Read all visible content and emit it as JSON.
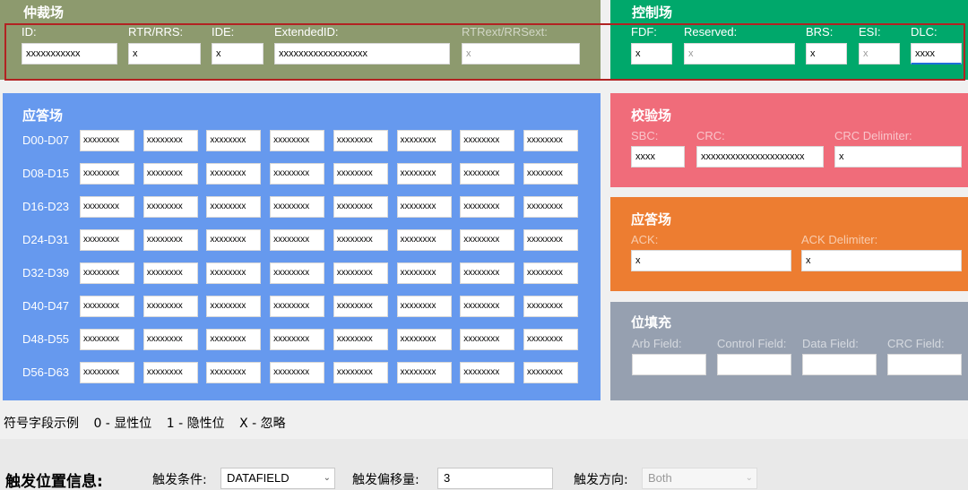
{
  "arbitration": {
    "title": "仲裁场",
    "fields": [
      {
        "label": "ID:",
        "value": "xxxxxxxxxxx"
      },
      {
        "label": "RTR/RRS:",
        "value": "x"
      },
      {
        "label": "IDE:",
        "value": "x"
      },
      {
        "label": "ExtendedID:",
        "value": "xxxxxxxxxxxxxxxxxx"
      },
      {
        "label": "RTRext/RRSext:",
        "value": "x"
      }
    ]
  },
  "control": {
    "title": "控制场",
    "fields": [
      {
        "label": "FDF:",
        "value": "x"
      },
      {
        "label": "Reserved:",
        "value": "x"
      },
      {
        "label": "BRS:",
        "value": "x"
      },
      {
        "label": "ESI:",
        "value": "x"
      },
      {
        "label": "DLC:",
        "value": "xxxx"
      }
    ]
  },
  "data": {
    "title": "应答场",
    "cell_value": "xxxxxxxx",
    "rows": [
      "D00-D07",
      "D08-D15",
      "D16-D23",
      "D24-D31",
      "D32-D39",
      "D40-D47",
      "D48-D55",
      "D56-D63"
    ]
  },
  "crc": {
    "title": "校验场",
    "fields": [
      {
        "label": "SBC:",
        "value": "xxxx"
      },
      {
        "label": "CRC:",
        "value": "xxxxxxxxxxxxxxxxxxxxx"
      },
      {
        "label": "CRC Delimiter:",
        "value": "x"
      }
    ]
  },
  "ack": {
    "title": "应答场",
    "fields": [
      {
        "label": "ACK:",
        "value": "x"
      },
      {
        "label": "ACK Delimiter:",
        "value": "x"
      }
    ]
  },
  "stuff": {
    "title": "位填充",
    "fields": [
      {
        "label": "Arb Field:",
        "value": ""
      },
      {
        "label": "Control Field:",
        "value": ""
      },
      {
        "label": "Data Field:",
        "value": ""
      },
      {
        "label": "CRC Field:",
        "value": ""
      }
    ]
  },
  "legend": {
    "caption": "符号字段示例",
    "dominant": "0 - 显性位",
    "recessive": "1 - 隐性位",
    "ignore": "X - 忽略"
  },
  "trigger": {
    "title": "触发位置信息:",
    "condition_label": "触发条件:",
    "condition_value": "DATAFIELD",
    "offset_label": "触发偏移量:",
    "offset_value": "3",
    "direction_label": "触发方向:",
    "direction_value": "Both"
  },
  "colors": {
    "arbitration": "#8d9a6e",
    "control": "#00a86b",
    "data": "#6699ee",
    "crc": "#f06c7a",
    "ack": "#ed7d31",
    "stuff": "#96a0b0",
    "selection": "#b22222"
  }
}
